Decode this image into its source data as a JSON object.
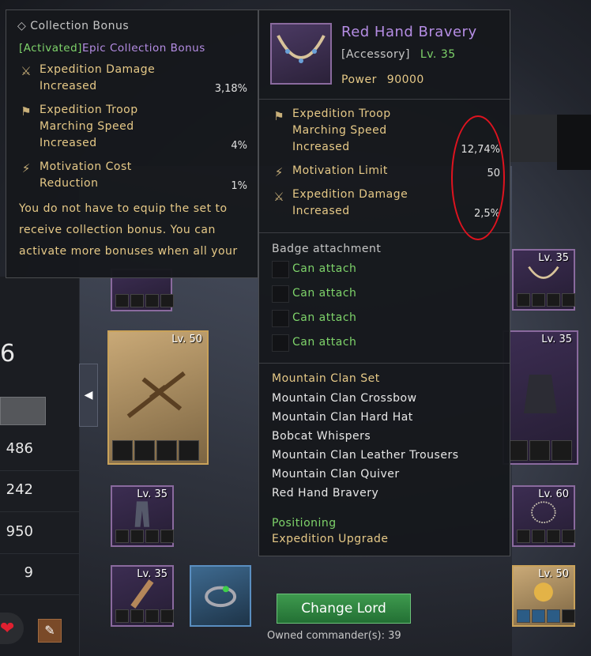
{
  "collection_bonus": {
    "header": "Collection Bonus",
    "activated_tag": "[Activated]",
    "activated_name": "Epic Collection Bonus",
    "bonuses": [
      {
        "icon": "expedition-damage-icon",
        "lines": [
          "Expedition Damage",
          "Increased"
        ],
        "value": "3,18%"
      },
      {
        "icon": "expedition-troop-speed-icon",
        "lines": [
          "Expedition Troop",
          "Marching Speed",
          "Increased"
        ],
        "value": "4%"
      },
      {
        "icon": "motivation-cost-icon",
        "lines": [
          "Motivation Cost",
          "Reduction"
        ],
        "value": "1%"
      }
    ],
    "description": [
      "You do not have to equip the set to",
      "receive collection bonus. You can",
      "activate more bonuses when all your"
    ]
  },
  "item_detail": {
    "name": "Red Hand Bravery",
    "type": "[Accessory]",
    "level": "Lv. 35",
    "power_label": "Power",
    "power_value": "90000",
    "stats": [
      {
        "icon": "expedition-troop-speed-icon",
        "lines": [
          "Expedition Troop",
          "Marching Speed",
          "Increased"
        ],
        "value": "12,74%"
      },
      {
        "icon": "motivation-limit-icon",
        "lines": [
          "Motivation Limit"
        ],
        "value": "50"
      },
      {
        "icon": "expedition-damage-icon",
        "lines": [
          "Expedition Damage",
          "Increased"
        ],
        "value": "2,5%"
      }
    ],
    "badge_header": "Badge attachment",
    "badges": [
      "Can attach",
      "Can attach",
      "Can attach",
      "Can attach"
    ],
    "set_title": "Mountain Clan Set",
    "set_items": [
      "Mountain Clan Crossbow",
      "Mountain Clan Hard Hat",
      "Bobcat Whispers",
      "Mountain Clan Leather Trousers",
      "Mountain Clan Quiver",
      "Red Hand Bravery"
    ],
    "footer_lines": [
      "Positioning",
      "Expedition Upgrade"
    ]
  },
  "equipment_slots": {
    "crossbow_level": "Lv. 50",
    "trousers_level": "Lv. 35",
    "quiver_level": "Lv. 35",
    "necklace_level": "Lv. 35",
    "armor_level": "Lv. 35",
    "chain_level": "Lv. 60",
    "gold_item_level": "Lv. 50"
  },
  "left_stats": {
    "big_value": "6",
    "values": [
      "486",
      "242",
      "950",
      "9"
    ]
  },
  "actions": {
    "change_lord": "Change Lord",
    "owned_commanders": "Owned commander(s): 39"
  },
  "colors": {
    "item_name": "#b58de4",
    "level_green": "#7ed36a",
    "set_gold": "#e6c987",
    "highlight_circle": "#e0131f",
    "button_green": "#3e9a4e"
  }
}
